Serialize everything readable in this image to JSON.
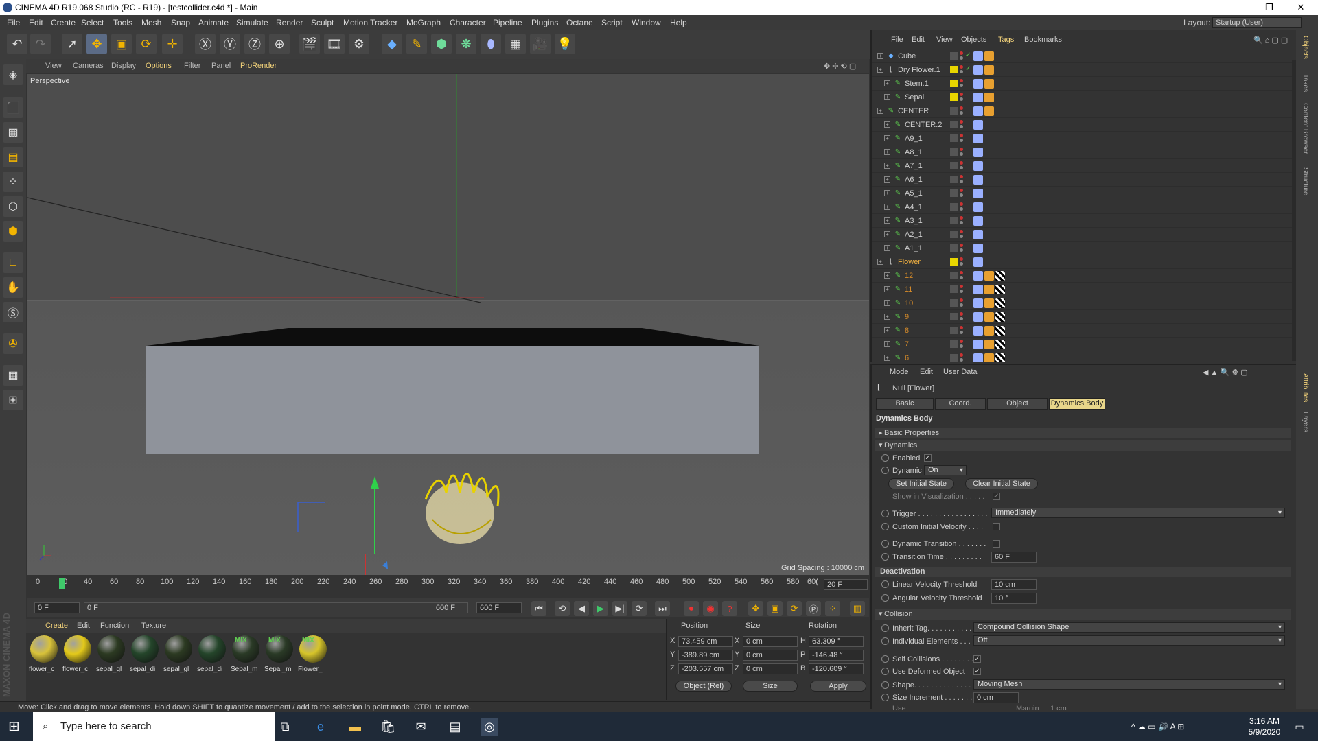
{
  "window": {
    "title": "CINEMA 4D R19.068 Studio (RC - R19) - [testcollider.c4d *] - Main",
    "minimize": "–",
    "maximize": "❐",
    "close": "✕"
  },
  "menu": [
    "File",
    "Edit",
    "Create",
    "Select",
    "Tools",
    "Mesh",
    "Snap",
    "Animate",
    "Simulate",
    "Render",
    "Sculpt",
    "Motion Tracker",
    "MoGraph",
    "Character",
    "Pipeline",
    "Plugins",
    "Octane",
    "Script",
    "Window",
    "Help"
  ],
  "layout": {
    "label": "Layout:",
    "value": "Startup (User)"
  },
  "viewport": {
    "menu": [
      "View",
      "Cameras",
      "Display",
      "Options",
      "Filter",
      "Panel",
      "ProRender"
    ],
    "label": "Perspective",
    "grid": "Grid Spacing : 10000 cm"
  },
  "timeline": {
    "ticks": [
      "0",
      "20",
      "40",
      "60",
      "80",
      "100",
      "120",
      "140",
      "160",
      "180",
      "200",
      "220",
      "240",
      "260",
      "280",
      "300",
      "320",
      "340",
      "360",
      "380",
      "400",
      "420",
      "440",
      "460",
      "480",
      "500",
      "520",
      "540",
      "560",
      "580",
      "60("
    ],
    "current": "20 F",
    "start": "0 F",
    "range_start": "0 F",
    "range_end": "600 F",
    "end": "600 F"
  },
  "materials": {
    "menu": [
      "Create",
      "Edit",
      "Function",
      "Texture"
    ],
    "items": [
      {
        "name": "flower_c",
        "color": "#d8c23a",
        "mix": ""
      },
      {
        "name": "flower_c",
        "color": "#e3c91a",
        "mix": ""
      },
      {
        "name": "sepal_gl",
        "color": "#2c3a22",
        "mix": ""
      },
      {
        "name": "sepal_di",
        "color": "#24452a",
        "mix": ""
      },
      {
        "name": "sepal_gl",
        "color": "#2c3a22",
        "mix": ""
      },
      {
        "name": "sepal_di",
        "color": "#24452a",
        "mix": ""
      },
      {
        "name": "Sepal_m",
        "color": "#2a3a26",
        "mix": "MIX"
      },
      {
        "name": "Sepal_m",
        "color": "#2a3a26",
        "mix": "MIX"
      },
      {
        "name": "Flower_",
        "color": "#d7c52a",
        "mix": "MIX"
      }
    ]
  },
  "coords": {
    "headers": [
      "Position",
      "Size",
      "Rotation"
    ],
    "rows": [
      {
        "axis": "X",
        "pos": "73.459 cm",
        "sax": "X",
        "size": "0 cm",
        "rax": "H",
        "rot": "63.309 °"
      },
      {
        "axis": "Y",
        "pos": "-389.89 cm",
        "sax": "Y",
        "size": "0 cm",
        "rax": "P",
        "rot": "-146.48 °"
      },
      {
        "axis": "Z",
        "pos": "-203.557 cm",
        "sax": "Z",
        "size": "0 cm",
        "rax": "B",
        "rot": "-120.609 °"
      }
    ],
    "mode": "Object (Rel)",
    "sizemode": "Size",
    "apply": "Apply"
  },
  "status": "Move: Click and drag to move elements. Hold down SHIFT to quantize movement / add to the selection in point mode, CTRL to remove.",
  "objects": {
    "menu": [
      "File",
      "Edit",
      "View",
      "Objects",
      "Tags",
      "Bookmarks"
    ],
    "rows": [
      {
        "name": "Cube",
        "indent": 0,
        "color": "#ccc",
        "layer": false
      },
      {
        "name": "Dry Flower.1",
        "indent": 0,
        "color": "#ccc",
        "layer": true
      },
      {
        "name": "Stem.1",
        "indent": 1,
        "color": "#ccc",
        "layer": true
      },
      {
        "name": "Sepal",
        "indent": 1,
        "color": "#ccc",
        "layer": true
      },
      {
        "name": "CENTER",
        "indent": 0,
        "color": "#ccc",
        "layer": false
      },
      {
        "name": "CENTER.2",
        "indent": 1,
        "color": "#ccc",
        "layer": false
      },
      {
        "name": "A9_1",
        "indent": 1,
        "color": "#ccc",
        "layer": false
      },
      {
        "name": "A8_1",
        "indent": 1,
        "color": "#ccc",
        "layer": false
      },
      {
        "name": "A7_1",
        "indent": 1,
        "color": "#ccc",
        "layer": false
      },
      {
        "name": "A6_1",
        "indent": 1,
        "color": "#ccc",
        "layer": false
      },
      {
        "name": "A5_1",
        "indent": 1,
        "color": "#ccc",
        "layer": false
      },
      {
        "name": "A4_1",
        "indent": 1,
        "color": "#ccc",
        "layer": false
      },
      {
        "name": "A3_1",
        "indent": 1,
        "color": "#ccc",
        "layer": false
      },
      {
        "name": "A2_1",
        "indent": 1,
        "color": "#ccc",
        "layer": false
      },
      {
        "name": "A1_1",
        "indent": 1,
        "color": "#ccc",
        "layer": false
      },
      {
        "name": "Flower",
        "indent": 0,
        "color": "#f0b040",
        "layer": true
      },
      {
        "name": "12",
        "indent": 1,
        "color": "#d48a2a",
        "layer": false
      },
      {
        "name": "11",
        "indent": 1,
        "color": "#d48a2a",
        "layer": false
      },
      {
        "name": "10",
        "indent": 1,
        "color": "#d48a2a",
        "layer": false
      },
      {
        "name": "9",
        "indent": 1,
        "color": "#d48a2a",
        "layer": false
      },
      {
        "name": "8",
        "indent": 1,
        "color": "#d48a2a",
        "layer": false
      },
      {
        "name": "7",
        "indent": 1,
        "color": "#d48a2a",
        "layer": false
      },
      {
        "name": "6",
        "indent": 1,
        "color": "#d48a2a",
        "layer": false
      }
    ]
  },
  "attributes": {
    "menu": [
      "Mode",
      "Edit",
      "User Data"
    ],
    "object": "Null [Flower]",
    "tabs": [
      "Basic",
      "Coord.",
      "Object",
      "Dynamics Body"
    ],
    "heading": "Dynamics Body",
    "basic_properties": "Basic Properties",
    "dynamics": "Dynamics",
    "enabled": "Enabled",
    "dynamic": "Dynamic",
    "dynamic_val": "On",
    "set_initial": "Set Initial State",
    "clear_initial": "Clear Initial State",
    "show_vis": "Show in Visualization . . . . .",
    "trigger": "Trigger . . . . . . . . . . . . . . . . .",
    "trigger_val": "Immediately",
    "custom_vel": "Custom Initial Velocity . . . .",
    "dyn_trans": "Dynamic Transition . . . . . . .",
    "trans_time": "Transition Time . . . . . . . . .",
    "trans_val": "60 F",
    "deactivation": "Deactivation",
    "lin_vel": "Linear Velocity Threshold",
    "lin_val": "10 cm",
    "ang_vel": "Angular Velocity Threshold",
    "ang_val": "10 °",
    "collision": "Collision",
    "inherit": "Inherit Tag. . . . . . . . . . .",
    "inherit_val": "Compound Collision Shape",
    "individual": "Individual Elements . . .",
    "individual_val": "Off",
    "self_col": "Self Collisions . . . . . . . . .",
    "use_def": "Use Deformed Object",
    "shape": "Shape. . . . . . . . . . . . . . . . .",
    "shape_val": "Moving Mesh",
    "size_inc": "Size Increment . . . . . . .",
    "size_val": "0 cm",
    "use": "Use",
    "margin": "Margin",
    "margin_val": "1 cm"
  },
  "right_tabs": [
    "Objects",
    "Takes",
    "Content Browser",
    "Structure",
    "Attributes",
    "Layers"
  ],
  "taskbar": {
    "search": "Type here to search",
    "time": "3:16 AM",
    "date": "5/9/2020"
  }
}
